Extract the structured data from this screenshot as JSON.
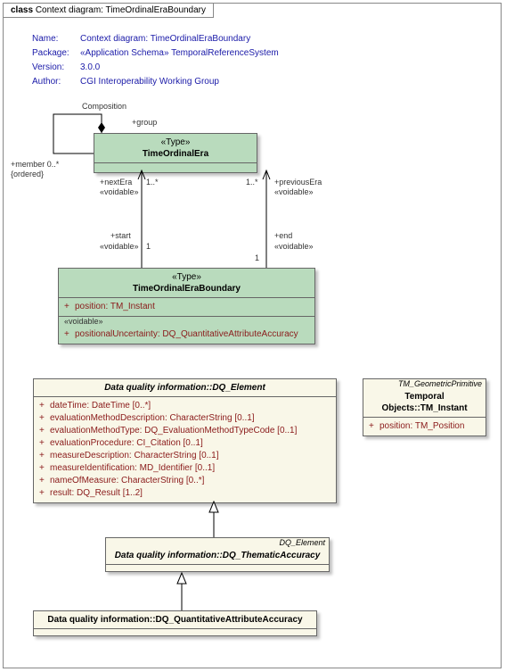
{
  "frame": {
    "title_prefix": "class ",
    "title": "Context diagram: TimeOrdinalEraBoundary"
  },
  "meta": {
    "name_lbl": "Name:",
    "name": "Context diagram: TimeOrdinalEraBoundary",
    "package_lbl": "Package:",
    "package": "«Application Schema» TemporalReferenceSystem",
    "version_lbl": "Version:",
    "version": "3.0.0",
    "author_lbl": "Author:",
    "author": "CGI Interoperability Working Group"
  },
  "classes": {
    "era": {
      "stereo": "«Type»",
      "name": "TimeOrdinalEra"
    },
    "boundary": {
      "stereo": "«Type»",
      "name": "TimeOrdinalEraBoundary",
      "attr1_vis": "+",
      "attr1": "position:  TM_Instant",
      "voidable_lbl": "«voidable»",
      "attr2_vis": "+",
      "attr2": "positionalUncertainty:  DQ_QuantitativeAttributeAccuracy"
    },
    "dq_element": {
      "name": "Data quality information::DQ_Element",
      "attrs": [
        {
          "vis": "+",
          "text": "dateTime:  DateTime [0..*]"
        },
        {
          "vis": "+",
          "text": "evaluationMethodDescription:  CharacterString [0..1]"
        },
        {
          "vis": "+",
          "text": "evaluationMethodType:  DQ_EvaluationMethodTypeCode [0..1]"
        },
        {
          "vis": "+",
          "text": "evaluationProcedure:  CI_Citation [0..1]"
        },
        {
          "vis": "+",
          "text": "measureDescription:  CharacterString [0..1]"
        },
        {
          "vis": "+",
          "text": "measureIdentification:  MD_Identifier [0..1]"
        },
        {
          "vis": "+",
          "text": "nameOfMeasure:  CharacterString [0..*]"
        },
        {
          "vis": "+",
          "text": "result:  DQ_Result [1..2]"
        }
      ]
    },
    "dq_thematic": {
      "tag": "DQ_Element",
      "name": "Data quality information::DQ_ThematicAccuracy"
    },
    "dq_quant": {
      "name": "Data quality information::DQ_QuantitativeAttributeAccuracy"
    },
    "tm_instant": {
      "tag": "TM_GeometricPrimitive",
      "name": "Temporal Objects::TM_Instant",
      "attr_vis": "+",
      "attr": "position:  TM_Position"
    }
  },
  "edges": {
    "composition": "Composition",
    "group": "+group",
    "member": "+member 0..*",
    "ordered": "{ordered}",
    "nextEra": "+nextEra",
    "nextEra_m": "1..*",
    "voidable": "«voidable»",
    "previousEra": "+previousEra",
    "prevEra_m": "1..*",
    "start": "+start",
    "start_m": "1",
    "end": "+end",
    "end_m": "1"
  }
}
